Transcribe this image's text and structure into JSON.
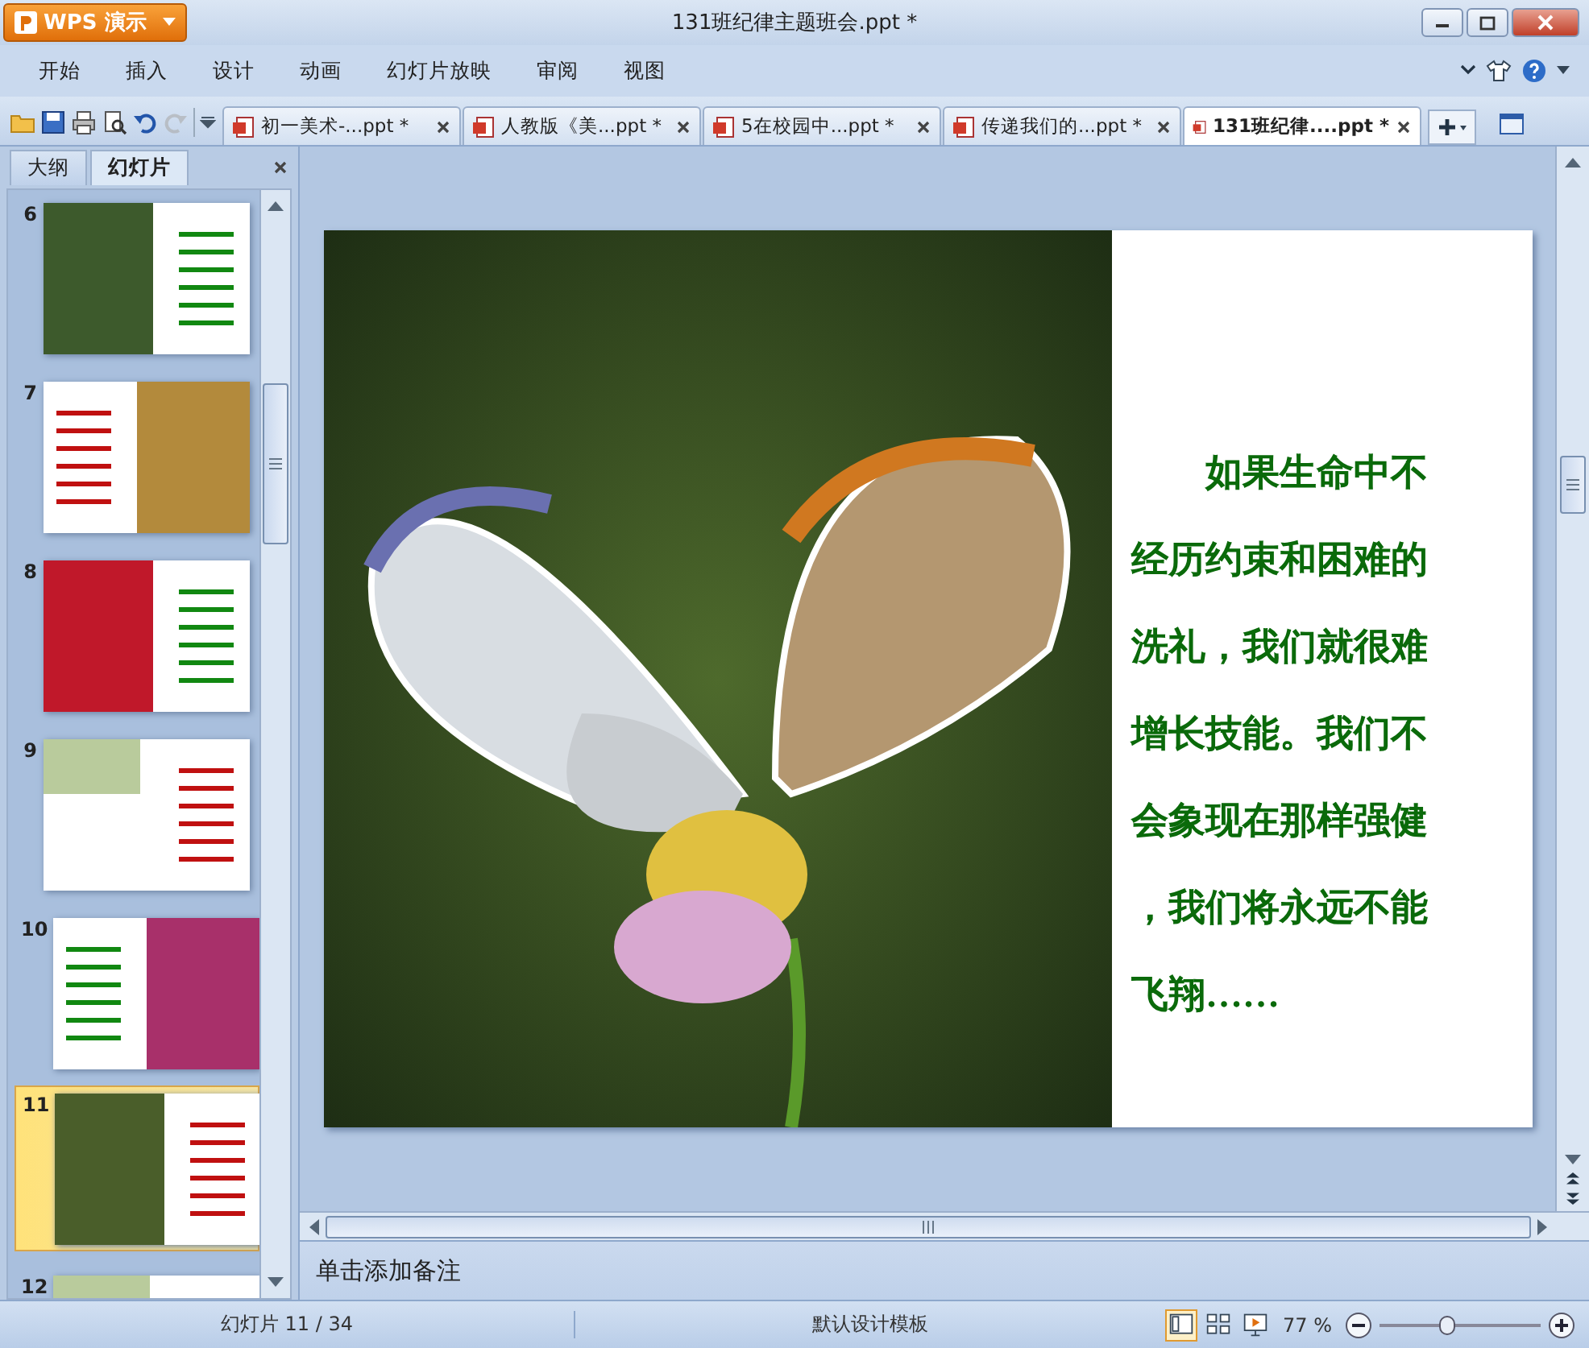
{
  "app_button": {
    "label": "WPS 演示"
  },
  "window": {
    "title": "131班纪律主题班会.ppt *"
  },
  "menu": [
    {
      "label": "开始"
    },
    {
      "label": "插入"
    },
    {
      "label": "设计"
    },
    {
      "label": "动画"
    },
    {
      "label": "幻灯片放映"
    },
    {
      "label": "审阅"
    },
    {
      "label": "视图"
    }
  ],
  "toolbar": [
    {
      "kind": "open",
      "disabled": false
    },
    {
      "kind": "save",
      "disabled": false
    },
    {
      "kind": "print",
      "disabled": false
    },
    {
      "kind": "preview",
      "disabled": false
    },
    {
      "kind": "undo",
      "disabled": false
    },
    {
      "kind": "redo",
      "disabled": true
    }
  ],
  "doc_tabs": [
    {
      "label": "初一美术-...ppt *",
      "selected": false
    },
    {
      "label": "人教版《美...ppt *",
      "selected": false
    },
    {
      "label": "5在校园中...ppt *",
      "selected": false
    },
    {
      "label": "传递我们的...ppt *",
      "selected": false
    },
    {
      "label": "131班纪律....ppt *",
      "selected": true
    }
  ],
  "panel_tabs": [
    {
      "label": "大纲",
      "selected": false
    },
    {
      "label": "幻灯片",
      "selected": true
    }
  ],
  "slides": [
    {
      "number": "6",
      "kind": "left-photo",
      "selected": false
    },
    {
      "number": "7",
      "kind": "right-photo",
      "selected": false
    },
    {
      "number": "8",
      "kind": "left-photo",
      "selected": false
    },
    {
      "number": "9",
      "kind": "text-only",
      "selected": false
    },
    {
      "number": "10",
      "kind": "right-photo",
      "selected": false
    },
    {
      "number": "11",
      "kind": "left-photo",
      "selected": true
    },
    {
      "number": "12",
      "kind": "text-only",
      "selected": false
    }
  ],
  "slide": {
    "lines": [
      "如果生命中不",
      "经历约束和困难的",
      "洗礼，我们就很难",
      "增长技能。我们不",
      "会象现在那样强健",
      "，我们将永远不能",
      "飞翔……"
    ]
  },
  "notes": {
    "placeholder": "单击添加备注"
  },
  "status_bar": {
    "slide_counter": "幻灯片 11 / 34",
    "template": "默认设计模板",
    "view_buttons": [
      {
        "kind": "normal",
        "selected": true
      },
      {
        "kind": "sorter",
        "selected": false
      },
      {
        "kind": "show",
        "selected": false
      }
    ],
    "zoom": {
      "reading": "77 %",
      "level": 0.42
    }
  }
}
